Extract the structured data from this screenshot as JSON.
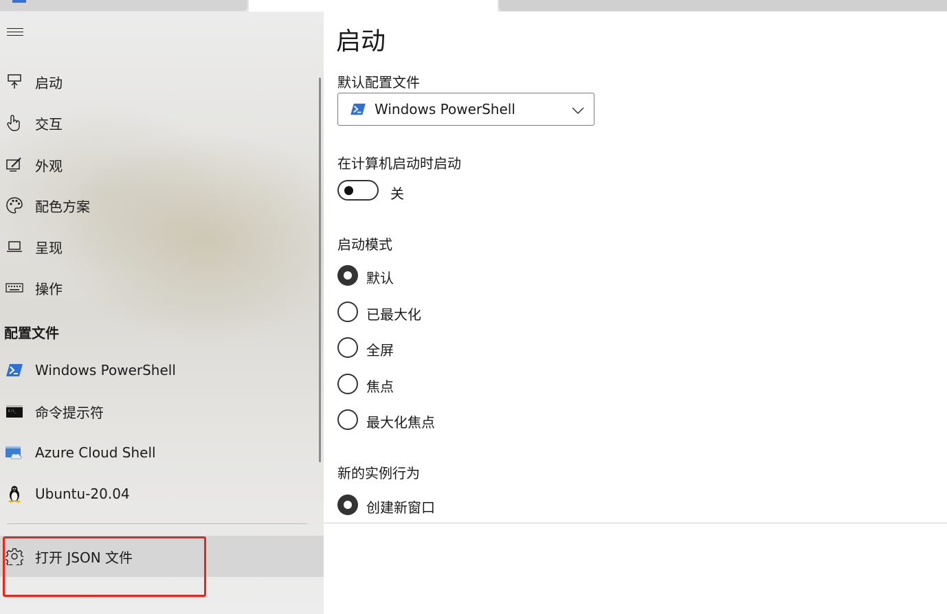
{
  "sidebar": {
    "nav": [
      {
        "label": "启动",
        "icon": "launch-icon"
      },
      {
        "label": "交互",
        "icon": "hand-pointer-icon"
      },
      {
        "label": "外观",
        "icon": "edit-display-icon"
      },
      {
        "label": "配色方案",
        "icon": "palette-icon"
      },
      {
        "label": "呈现",
        "icon": "monitor-icon"
      },
      {
        "label": "操作",
        "icon": "keyboard-icon"
      }
    ],
    "profiles_header": "配置文件",
    "profiles": [
      {
        "label": "Windows PowerShell",
        "icon": "powershell-icon"
      },
      {
        "label": "命令提示符",
        "icon": "command-prompt-icon"
      },
      {
        "label": "Azure Cloud Shell",
        "icon": "azure-cloud-shell-icon"
      },
      {
        "label": "Ubuntu-20.04",
        "icon": "linux-penguin-icon"
      }
    ],
    "open_json": {
      "label": "打开 JSON 文件",
      "icon": "gear-icon"
    }
  },
  "main": {
    "title": "启动",
    "default_profile": {
      "label": "默认配置文件",
      "value": "Windows PowerShell"
    },
    "launch_on_startup": {
      "label": "在计算机启动时启动",
      "state": "关"
    },
    "launch_mode": {
      "label": "启动模式",
      "options": [
        "默认",
        "已最大化",
        "全屏",
        "焦点",
        "最大化焦点"
      ],
      "selected": "默认"
    },
    "new_instance": {
      "label": "新的实例行为",
      "options": [
        "创建新窗口"
      ],
      "selected": "创建新窗口"
    }
  },
  "colors": {
    "highlight_border": "#e8251b",
    "accent": "#333333"
  }
}
